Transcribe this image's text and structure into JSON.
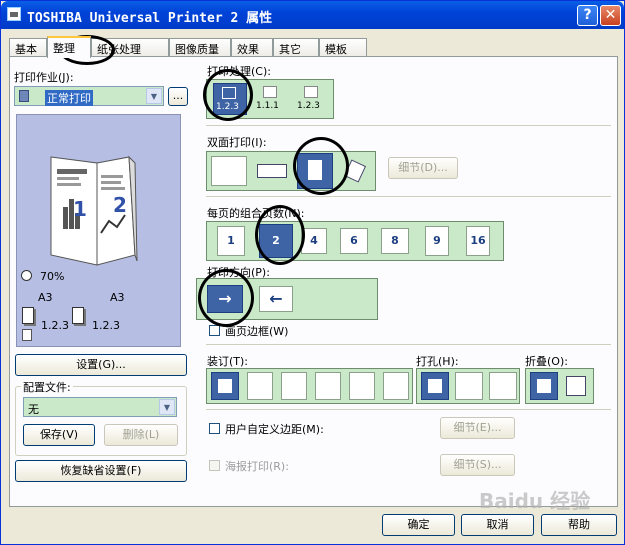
{
  "window": {
    "title": "TOSHIBA Universal Printer 2 属性",
    "help_btn": "?",
    "close_btn": "✕"
  },
  "tabs": [
    "基本",
    "整理",
    "纸张处理",
    "图像质量",
    "效果",
    "其它",
    "模板"
  ],
  "left": {
    "print_job_label": "打印作业(J):",
    "print_job_value": "正常打印",
    "more_btn": "...",
    "preview": {
      "zoom": "70%",
      "paper_left": "A3",
      "paper_right": "A3",
      "collate_left": "1.2.3",
      "collate_right": "1.2.3",
      "page_num_left": "1",
      "page_num_right": "2"
    },
    "settings_btn": "设置(G)...",
    "profile_label": "配置文件:",
    "profile_value": "无",
    "save_btn": "保存(V)",
    "delete_btn": "删除(L)",
    "restore_btn": "恢复缺省设置(F)"
  },
  "right": {
    "sort_label": "打印处理(C):",
    "sort_options": [
      "1.2.3",
      "1.1.1",
      "1.2.3"
    ],
    "duplex_label": "双面打印(I):",
    "duplex_details_btn": "细节(D)...",
    "nup_label": "每页的组合页数(N):",
    "nup_options": [
      "1",
      "2",
      "4",
      "6",
      "8",
      "9",
      "16"
    ],
    "direction_label": "打印方向(P):",
    "page_border_label": "画页边框(W)",
    "binding_label": "装订(T):",
    "punch_label": "打孔(H):",
    "fold_label": "折叠(O):",
    "custom_margin_label": "用户自定义边距(M):",
    "custom_margin_details_btn": "细节(E)...",
    "poster_label": "海报打印(R):",
    "poster_details_btn": "细节(S)..."
  },
  "footer": {
    "ok": "确定",
    "cancel": "取消",
    "help": "帮助"
  },
  "watermark": "Baidu 经验"
}
